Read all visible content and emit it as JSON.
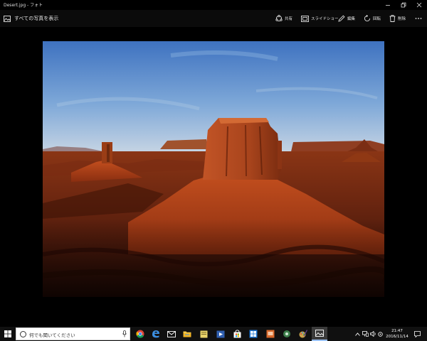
{
  "window": {
    "title": "Desert.jpg - フォト"
  },
  "appbar": {
    "all_photos_label": "すべての写真を表示",
    "commands": {
      "share": "共有",
      "slideshow": "スライドショー",
      "edit": "編集",
      "rotate": "回転",
      "delete": "削除"
    }
  },
  "taskbar": {
    "search_placeholder": "何でも聞いてください",
    "time": "21:47",
    "date": "2016/11/14"
  }
}
